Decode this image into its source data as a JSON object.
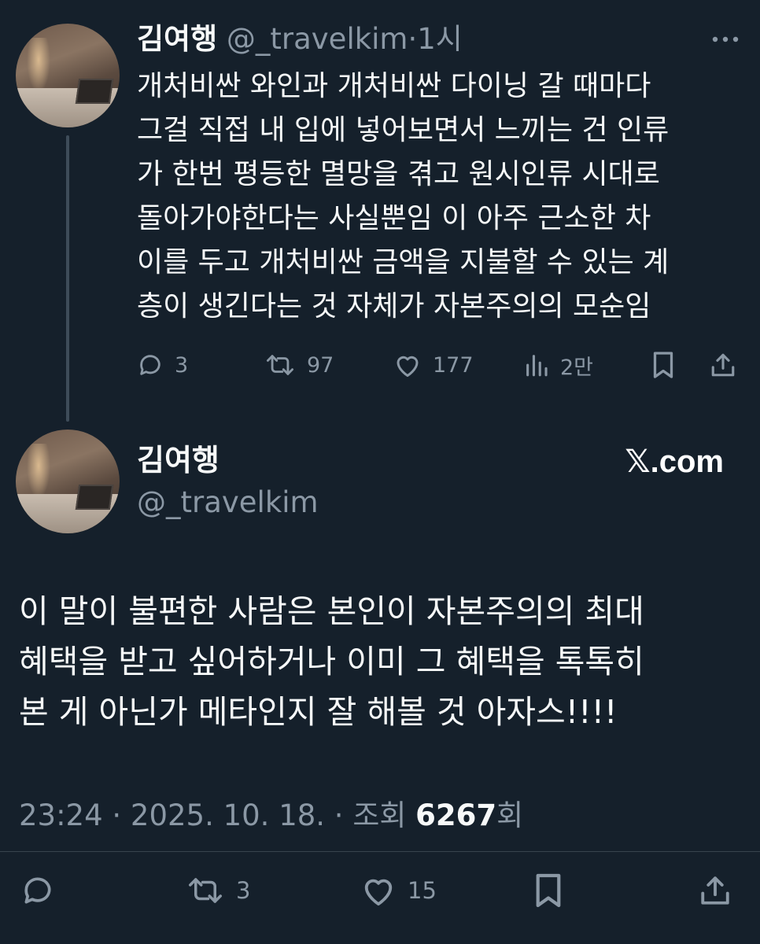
{
  "tweet1": {
    "name": "김여행",
    "handle": "@_travelkim",
    "separator": "·",
    "time": "1시",
    "lines": [
      "개처비싼 와인과 개처비싼 다이닝 갈 때마다",
      "그걸 직접 내 입에 넣어보면서 느끼는 건 인류",
      "가 한번 평등한 멸망을 겪고 원시인류 시대로",
      "돌아가야한다는 사실뿐임 이 아주 근소한 차",
      "이를 두고 개처비싼 금액을 지불할 수 있는 계",
      "층이 생긴다는 것 자체가 자본주의의 모순임"
    ],
    "replies": "3",
    "retweets": "97",
    "likes": "177",
    "views": "2만"
  },
  "tweet2": {
    "name": "김여행",
    "handle": "@_travelkim",
    "brand": "𝕏.com",
    "lines": [
      "이 말이 불편한 사람은 본인이 자본주의의 최대",
      "혜택을 받고 싶어하거나 이미 그 혜택을 톡톡히",
      "본 게 아닌가 메타인지 잘 해볼 것 아자스!!!!"
    ],
    "timestamp": "23:24 · 2025. 10. 18. · 조회 ",
    "views_count": "6267",
    "views_suffix": "회",
    "retweets": "3",
    "likes": "15"
  },
  "colors": {
    "background": "#15202b",
    "text": "#f7f9f9",
    "muted": "#8b98a5",
    "thread_line": "#3e4c59"
  },
  "icons": {
    "more": "more-horizontal-icon",
    "reply": "reply-icon",
    "retweet": "retweet-icon",
    "like": "heart-icon",
    "views": "views-chart-icon",
    "bookmark": "bookmark-icon",
    "share": "share-icon"
  }
}
